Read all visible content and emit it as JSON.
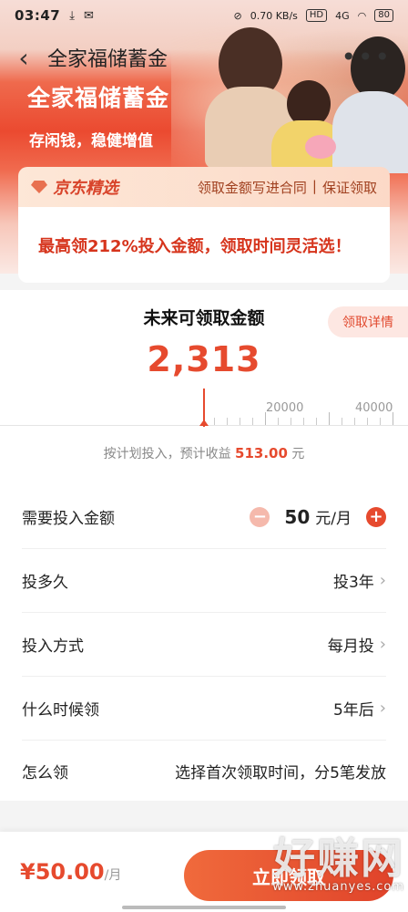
{
  "status_bar": {
    "time": "03:47",
    "speed": "0.70 KB/s",
    "signal": "4G",
    "hd": "HD",
    "battery": "80"
  },
  "nav": {
    "title": "全家福储蓄金"
  },
  "hero": {
    "title": "全家福储蓄金",
    "subtitle": "存闲钱，稳健增值"
  },
  "jd": {
    "brand": "京东精选",
    "tag1": "领取金额写进合同",
    "sep": "|",
    "tag2": "保证领取"
  },
  "promo": {
    "text": "最高领212%投入金额，领取时间灵活选！"
  },
  "future": {
    "label": "未来可领取金额",
    "detail_button": "领取详情",
    "amount": "2,313"
  },
  "ruler": {
    "mark1": "20000",
    "mark2": "40000"
  },
  "estimate": {
    "prefix": "按计划投入，预计收益",
    "amount": "513.00",
    "suffix": "元"
  },
  "rows": [
    {
      "label": "需要投入金额",
      "amount": "50",
      "unit": "元/月"
    },
    {
      "label": "投多久",
      "value": "投3年"
    },
    {
      "label": "投入方式",
      "value": "每月投"
    },
    {
      "label": "什么时候领",
      "value": "5年后"
    },
    {
      "label": "怎么领",
      "value": "选择首次领取时间，分5笔发放"
    }
  ],
  "bottom": {
    "price": "¥50.00",
    "unit": "/月",
    "cta": "立即领取"
  },
  "watermark": {
    "big": "好赚网",
    "small": "www.zhuanyes.com"
  }
}
